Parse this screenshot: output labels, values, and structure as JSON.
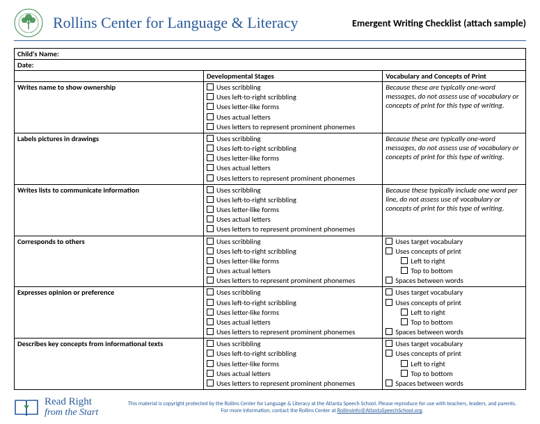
{
  "header": {
    "org": "Rollins Center for Language & Literacy",
    "doc_title": "Emergent Writing Checklist (attach sample)"
  },
  "fields": {
    "name_label": "Child's Name:",
    "date_label": "Date:"
  },
  "columns": {
    "c0": "",
    "c1": "Developmental Stages",
    "c2": "Vocabulary and Concepts of Print"
  },
  "dev_options": [
    "Uses scribbling",
    "Uses left-to-right scribbling",
    "Uses letter-like forms",
    "Uses actual letters",
    "Uses letters to represent prominent phonemes"
  ],
  "vocab_options": {
    "target": "Uses target vocabulary",
    "concepts": "Uses concepts of print",
    "ltr": "Left to right",
    "ttb": "Top to bottom",
    "spaces": "Spaces between words"
  },
  "note_oneword": "Because these are typically one-word messages, do not assess use of vocabulary or concepts of print for this type of writing.",
  "note_list": "Because these typically include one word per line, do not assess use of vocabulary or concepts of print for this type of writing.",
  "rows": [
    {
      "label": "Writes name to show ownership",
      "right": "note_oneword"
    },
    {
      "label": "Labels pictures in drawings",
      "right": "note_oneword"
    },
    {
      "label": "Writes lists to communicate information",
      "right": "note_list"
    },
    {
      "label": "Corresponds to others",
      "right": "vocab"
    },
    {
      "label": "Expresses opinion or preference",
      "right": "vocab"
    },
    {
      "label": "Describes key concepts from informational texts",
      "right": "vocab"
    }
  ],
  "footer": {
    "brand_top": "Read Right",
    "brand_bot": "from the Start",
    "text_a": "This material is copyright protected by the Rollins Center for Language & Literacy at the Atlanta Speech School. Please reproduce for use with teachers, leaders, and parents. For more information, contact the Rollins Center at ",
    "link": "Rollinsinfo@AtlantaSpeechSchool.org",
    "text_b": "."
  }
}
